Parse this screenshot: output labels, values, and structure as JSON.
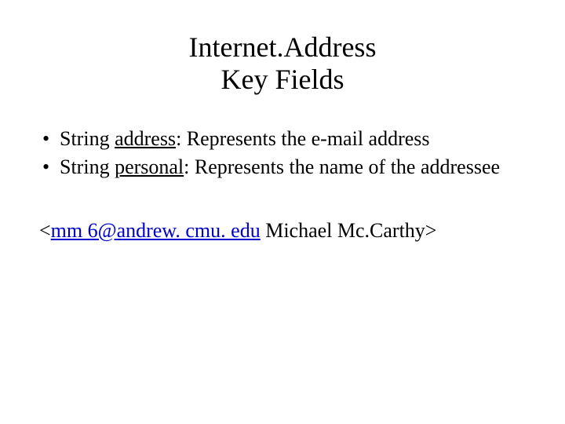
{
  "title": {
    "line1": "Internet.Address",
    "line2": "Key Fields"
  },
  "bullets": {
    "item1_prefix": "String ",
    "item1_field": "address",
    "item1_rest": ":  Represents the e-mail address",
    "item2_prefix": "String ",
    "item2_field": "personal",
    "item2_rest": ":  Represents the name of the addressee"
  },
  "example": {
    "lt": "<",
    "email": "mm 6@andrew. cmu. edu",
    "name": "  Michael Mc.Carthy>",
    "email_href": "mailto:mm6@andrew.cmu.edu"
  }
}
